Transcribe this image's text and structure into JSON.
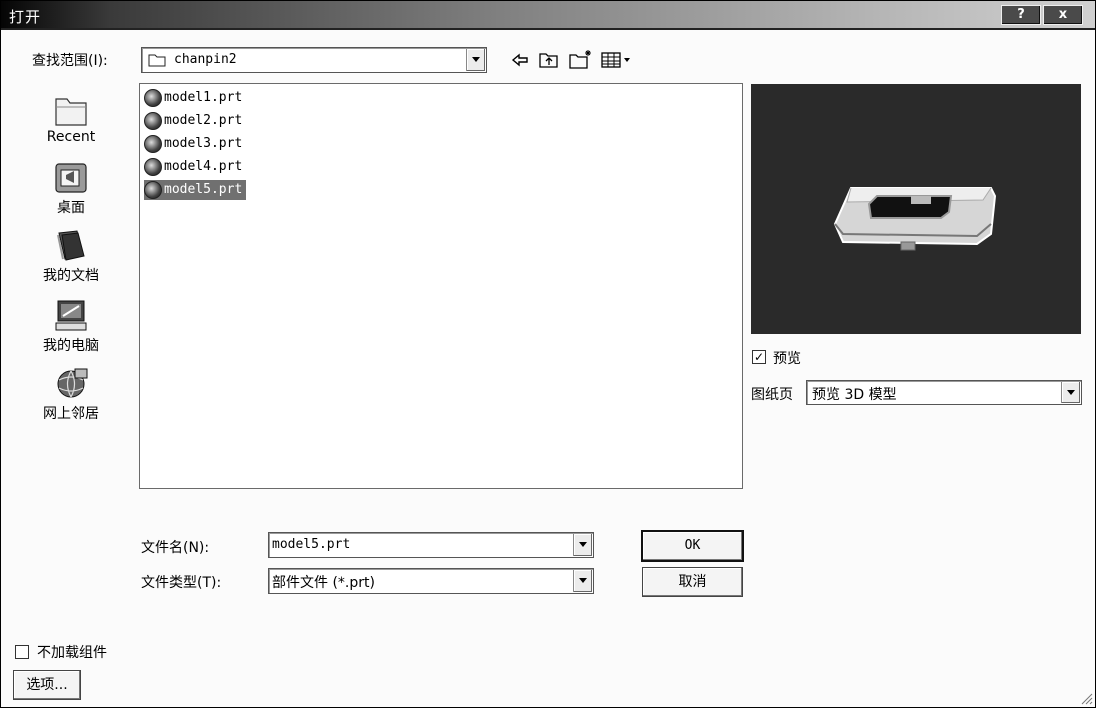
{
  "window": {
    "title": "打开",
    "help_label": "?",
    "close_label": "x"
  },
  "lookin": {
    "label": "查找范围(I):",
    "value": "chanpin2"
  },
  "toolbar_icons": [
    "back-icon",
    "up-folder-icon",
    "new-folder-icon",
    "view-menu-icon"
  ],
  "places": [
    {
      "label": "Recent",
      "icon": "recent-folder-icon"
    },
    {
      "label": "桌面",
      "icon": "desktop-icon"
    },
    {
      "label": "我的文档",
      "icon": "my-documents-icon"
    },
    {
      "label": "我的电脑",
      "icon": "my-computer-icon"
    },
    {
      "label": "网上邻居",
      "icon": "network-icon"
    }
  ],
  "files": [
    {
      "name": "model1.prt",
      "selected": false
    },
    {
      "name": "model2.prt",
      "selected": false
    },
    {
      "name": "model3.prt",
      "selected": false
    },
    {
      "name": "model4.prt",
      "selected": false
    },
    {
      "name": "model5.prt",
      "selected": true
    }
  ],
  "filename": {
    "label": "文件名(N):",
    "value": "model5.prt"
  },
  "filetype": {
    "label": "文件类型(T):",
    "value": "部件文件 (*.prt)"
  },
  "buttons": {
    "ok": "OK",
    "cancel": "取消",
    "options": "选项..."
  },
  "preview": {
    "checkbox_label": "预览",
    "checked": true,
    "sheet_label": "图纸页",
    "sheet_value": "预览 3D 模型"
  },
  "no_load_components": {
    "label": "不加载组件",
    "checked": false
  },
  "colors": {
    "selection": "#707070",
    "preview_bg": "#2a2a2a"
  }
}
